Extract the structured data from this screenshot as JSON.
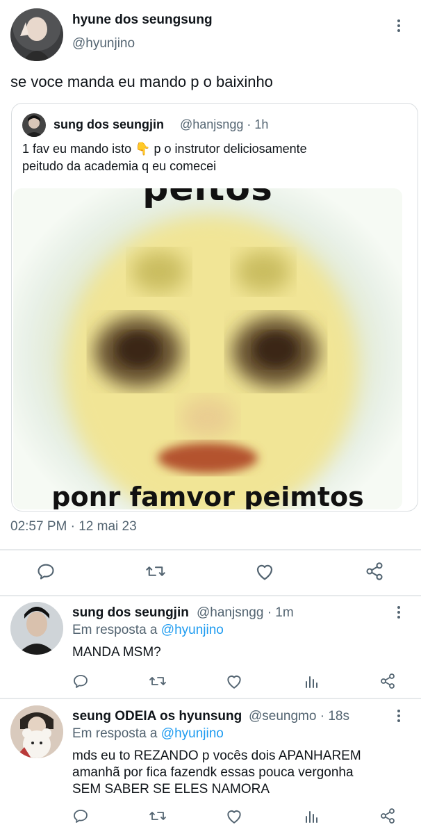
{
  "main_tweet": {
    "display_name": "hyune dos seungsung",
    "handle": "@hyunjino",
    "text": "se voce manda eu mando p o baixinho",
    "timestamp": "02:57 PM · 12 mai 23"
  },
  "quoted_tweet": {
    "display_name": "sung dos seungjin",
    "handle": "@hanjsngg · 1h",
    "text_line1_a": "1 fav eu mando isto ",
    "emoji": "👇",
    "text_line1_b": " p o instrutor deliciosamente",
    "text_line2": "peitudo da academia q eu comecei",
    "image_caption_top": "peitos",
    "image_caption_bottom": "ponr famvor peimtos"
  },
  "replies": [
    {
      "display_name": "sung dos seungjin",
      "handle": "@hanjsngg · 1m",
      "reply_prefix": "Em resposta a ",
      "reply_to": "@hyunjino",
      "text_lines": [
        "MANDA MSM?"
      ]
    },
    {
      "display_name": "seung ODEIA os hyunsung",
      "handle": "@seungmo · 18s",
      "reply_prefix": "Em resposta a ",
      "reply_to": "@hyunjino",
      "text_lines": [
        "mds eu to REZANDO p vocês dois APANHAREM",
        "amanhã por fica fazendk essas pouca vergonha",
        "SEM SABER SE ELES NAMORA"
      ]
    }
  ],
  "icons": [
    "more-vert-icon",
    "reply-icon",
    "retweet-icon",
    "like-icon",
    "share-icon",
    "analytics-icon"
  ],
  "colors": {
    "link": "#1d9bf0",
    "muted": "#536471",
    "text": "#0f1419",
    "divider": "#e6e9eb"
  }
}
